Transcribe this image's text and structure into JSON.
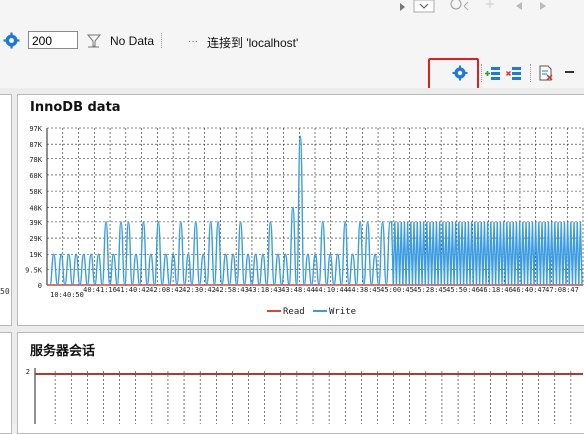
{
  "toolbar": {
    "interval_value": "200",
    "no_data_label": "No Data",
    "connection_label": "连接到 'localhost'"
  },
  "panels": {
    "left_partial_label": "50",
    "innodb_title": "InnoDB data",
    "sessions_title": "服务器会话"
  },
  "chart_data": [
    {
      "type": "line",
      "title": "InnoDB data",
      "ylabel": "",
      "xlabel": "",
      "ylim": [
        0,
        97000
      ],
      "y_ticks": [
        "97K",
        "87K",
        "78K",
        "68K",
        "58K",
        "48K",
        "39K",
        "29K",
        "19K",
        "9.5K",
        "0"
      ],
      "y_tick_values": [
        97000,
        87000,
        78000,
        68000,
        58000,
        48000,
        39000,
        29000,
        19000,
        9500,
        0
      ],
      "x_ticks": [
        "10:40:50",
        "40:41:16",
        "41:40:42",
        "42:08:42",
        "42:30:42",
        "42:58:43",
        "43:18:43",
        "43:48:44",
        "44:10:44",
        "44:38:45",
        "45:00:45",
        "45:28:45",
        "45:50:46",
        "46:18:46",
        "46:40:47",
        "47:08:47",
        "47:30"
      ],
      "legend_position": "bottom",
      "grid": true,
      "series": [
        {
          "name": "Read",
          "color": "#e0442f",
          "values": [
            0,
            0
          ]
        },
        {
          "name": "Write",
          "color": "#3b9de0",
          "values": [
            0,
            19000,
            0,
            19000,
            0,
            19000,
            0,
            19000,
            0,
            19000,
            0,
            19000,
            0,
            19000,
            0,
            39000,
            0,
            19000,
            0,
            39000,
            0,
            39000,
            0,
            19000,
            0,
            39000,
            0,
            19000,
            0,
            39000,
            0,
            19000,
            0,
            19000,
            0,
            39000,
            0,
            19000,
            0,
            39000,
            0,
            19000,
            0,
            39000,
            0,
            39000,
            0,
            19000,
            0,
            19000,
            0,
            39000,
            0,
            19000,
            0,
            19000,
            0,
            19000,
            0,
            39000,
            0,
            19000,
            0,
            19000,
            0,
            48000,
            0,
            92000,
            0,
            19000,
            0,
            19000,
            0,
            39000,
            0,
            19000,
            0,
            19000,
            0,
            39000,
            0,
            19000,
            0,
            39000,
            0,
            39000,
            0,
            19000,
            0,
            39000,
            0,
            39000
          ]
        }
      ],
      "dense_region": {
        "start_fraction": 0.64,
        "high": 39000,
        "low": 0
      }
    },
    {
      "type": "line",
      "title": "服务器会话",
      "y_ticks": [
        "2"
      ],
      "ylim": [
        0,
        2
      ],
      "grid": true,
      "series": [
        {
          "name": "",
          "color": "#b03a2e",
          "values": [
            2,
            2
          ]
        }
      ]
    }
  ]
}
